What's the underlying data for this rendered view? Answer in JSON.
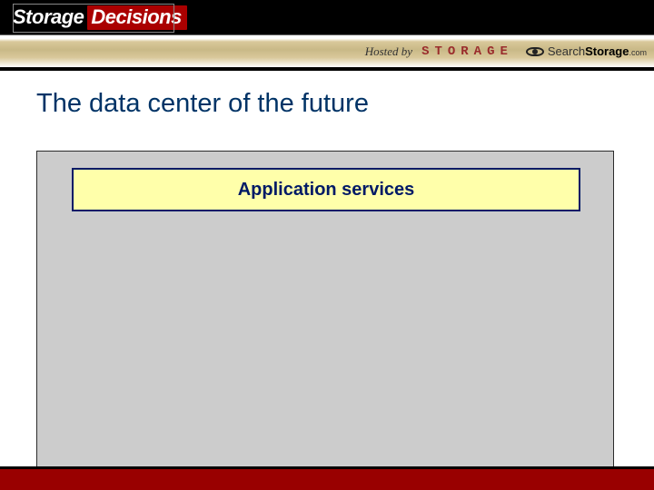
{
  "header": {
    "brand_word1": "Storage",
    "brand_word2": "Decisions",
    "hosted_by_label": "Hosted by",
    "magazine_logo_text": "STORAGE",
    "search_logo_part1": "Search",
    "search_logo_part2": "Storage",
    "search_logo_suffix": ".com"
  },
  "slide": {
    "title": "The data center of the future",
    "box1_label": "Application services"
  }
}
